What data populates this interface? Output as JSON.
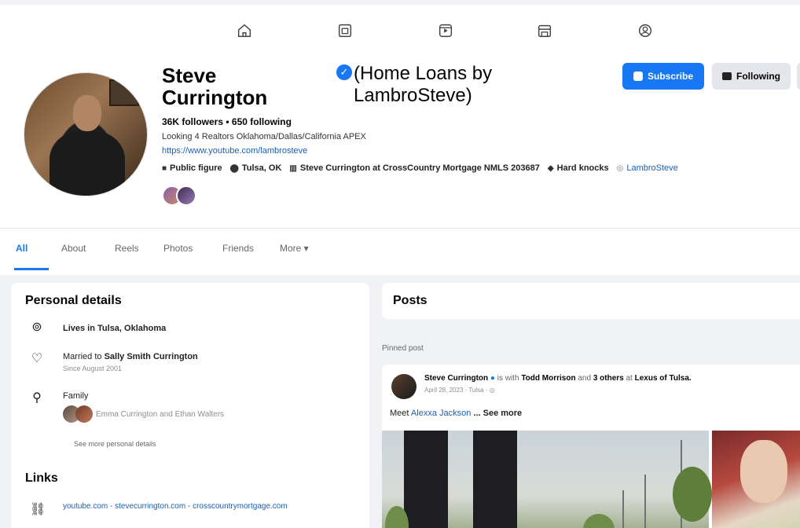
{
  "nav": {
    "icons": [
      "home-icon",
      "pages-icon",
      "video-icon",
      "marketplace-icon",
      "groups-icon"
    ]
  },
  "profile": {
    "name": "Steve Currington",
    "name_extra": "(Home Loans by LambroSteve)",
    "stats": "36K followers • 650 following",
    "bio": "Looking 4 Realtors Oklahoma/Dallas/California APEX",
    "link": "https://www.youtube.com/lambrosteve",
    "meta": {
      "category": "Public figure",
      "location": "Tulsa, OK",
      "work": "Steve Currington at CrossCountry Mortgage NMLS 203687",
      "school": "Hard knocks",
      "instagram": "LambroSteve"
    },
    "buttons": {
      "subscribe": "Subscribe",
      "following": "Following"
    }
  },
  "tabs": [
    "All",
    "About",
    "Reels",
    "Photos",
    "Friends",
    "More ▾"
  ],
  "personal_details": {
    "title": "Personal details",
    "lives": "Lives in Tulsa, Oklahoma",
    "married_prefix": "Married to",
    "married_name": "Sally Smith Currington",
    "married_since": "Since August 2001",
    "family_label": "Family",
    "family_members": "Emma Currington and Ethan Walters",
    "see_more": "See more personal details"
  },
  "links": {
    "title": "Links",
    "text": "youtube.com - stevecurrington.com - crosscountrymortgage.com"
  },
  "posts": {
    "title": "Posts",
    "pinned_label": "Pinned post",
    "author": "Steve Currington",
    "with_text": "is with",
    "tagged": "Todd Morrison",
    "and_text": "and",
    "others": "3 others",
    "at_text": "at",
    "place": "Lexus of Tulsa.",
    "date": "April 28, 2023 · Tulsa · ",
    "text_prefix": "Meet",
    "text_name": "Alexxa Jackson",
    "text_suffix": "... See more"
  },
  "colors": {
    "brand_blue": "#1877f2",
    "link_blue": "#1a5fb4",
    "background": "#f0f2f5"
  }
}
